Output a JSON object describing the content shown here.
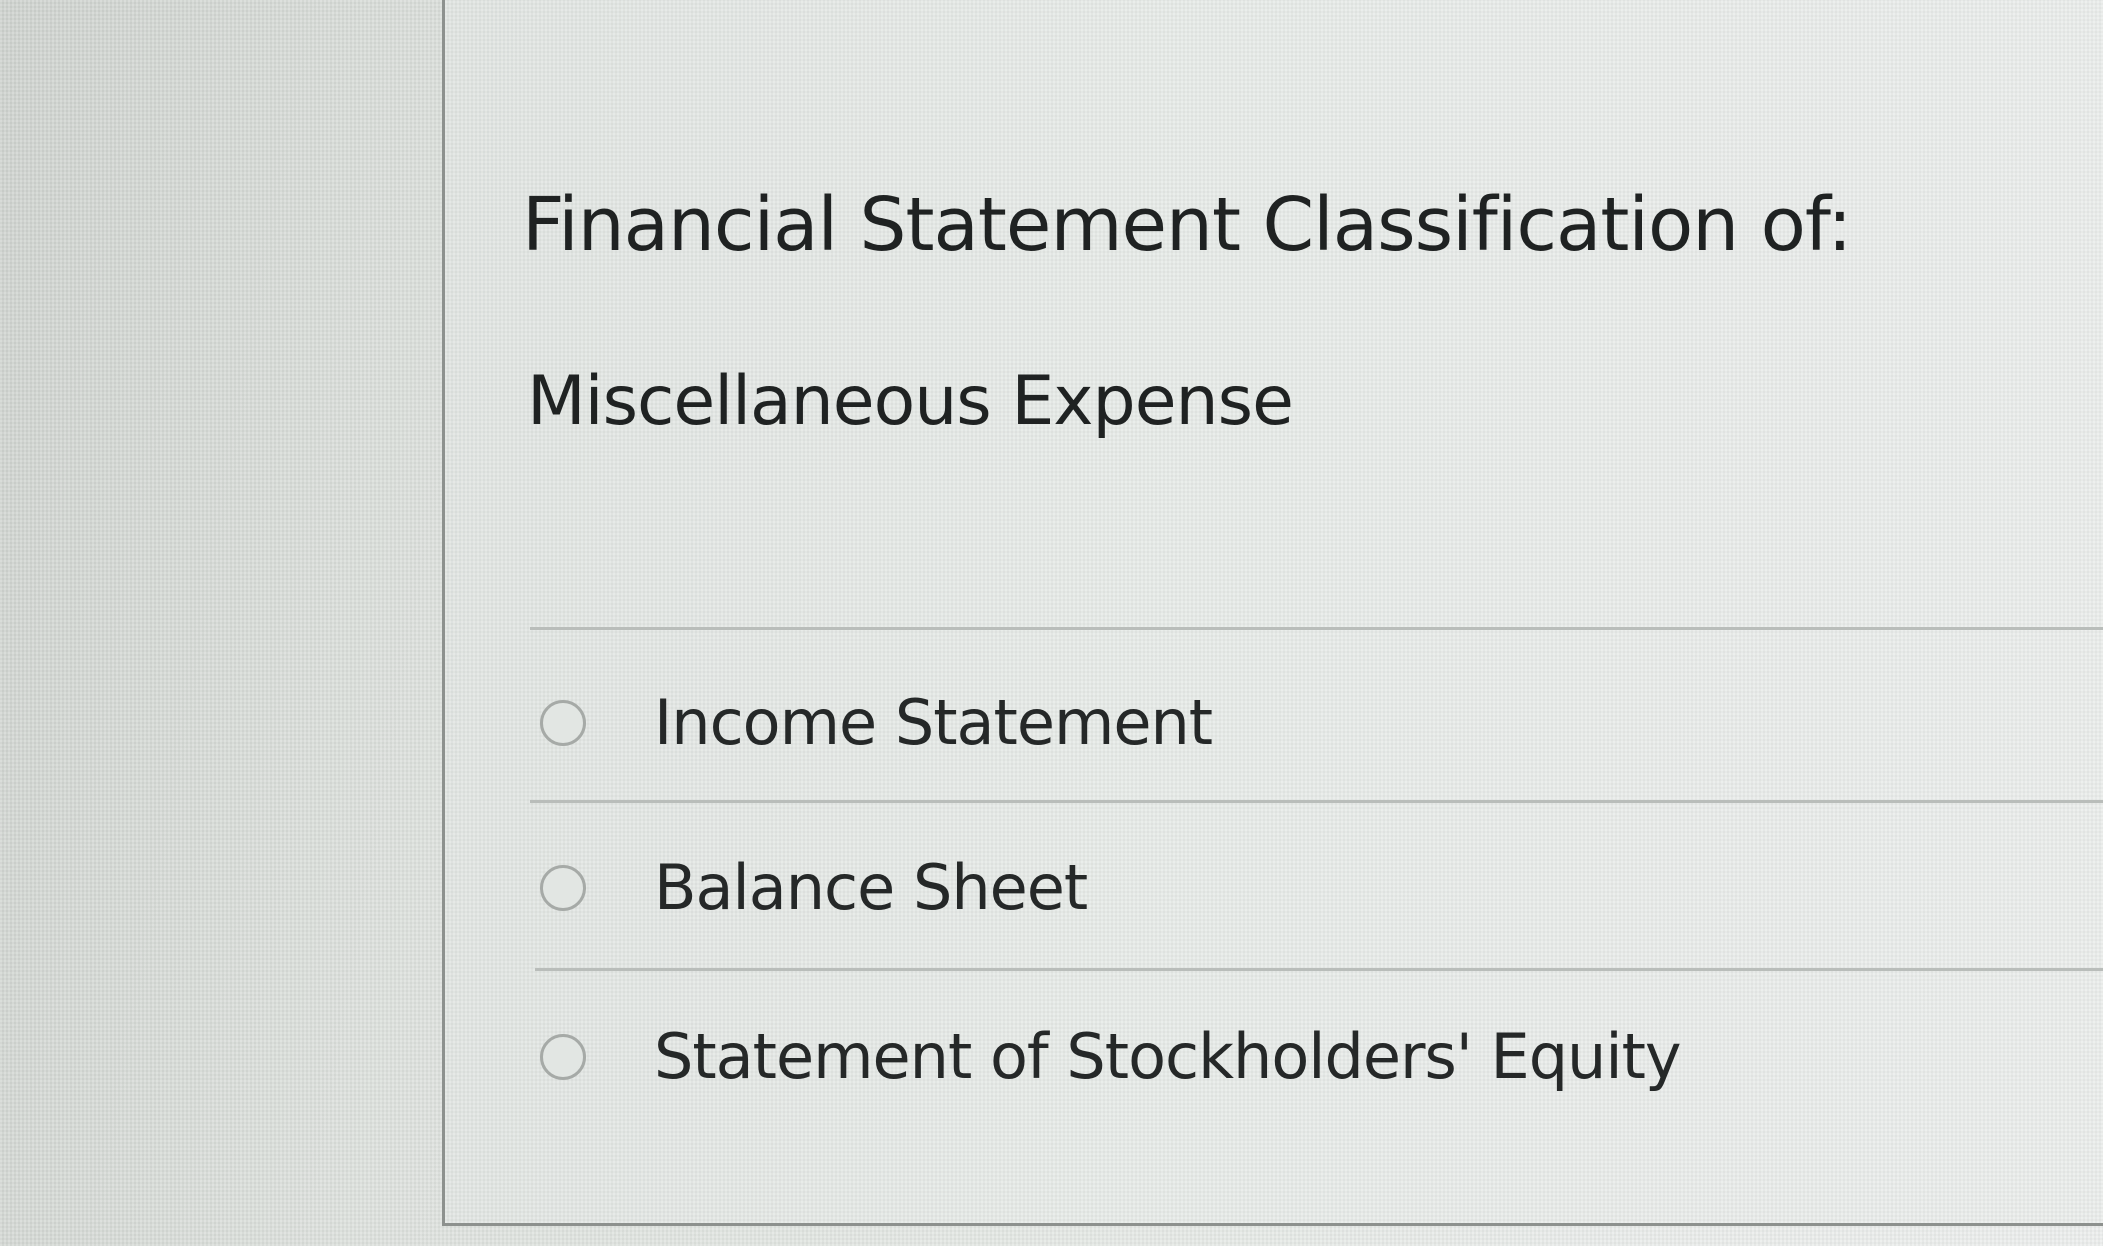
{
  "question": {
    "title": "Financial Statement Classification of:",
    "item": "Miscellaneous Expense"
  },
  "choices": [
    {
      "label": "Income Statement",
      "selected": false
    },
    {
      "label": "Balance Sheet",
      "selected": false
    },
    {
      "label": "Statement of Stockholders' Equity",
      "selected": false
    }
  ],
  "colors": {
    "text": "#1f2222",
    "border": "#8d918e",
    "divider": "#b9bdba",
    "radio_border": "#a6aaa7"
  }
}
